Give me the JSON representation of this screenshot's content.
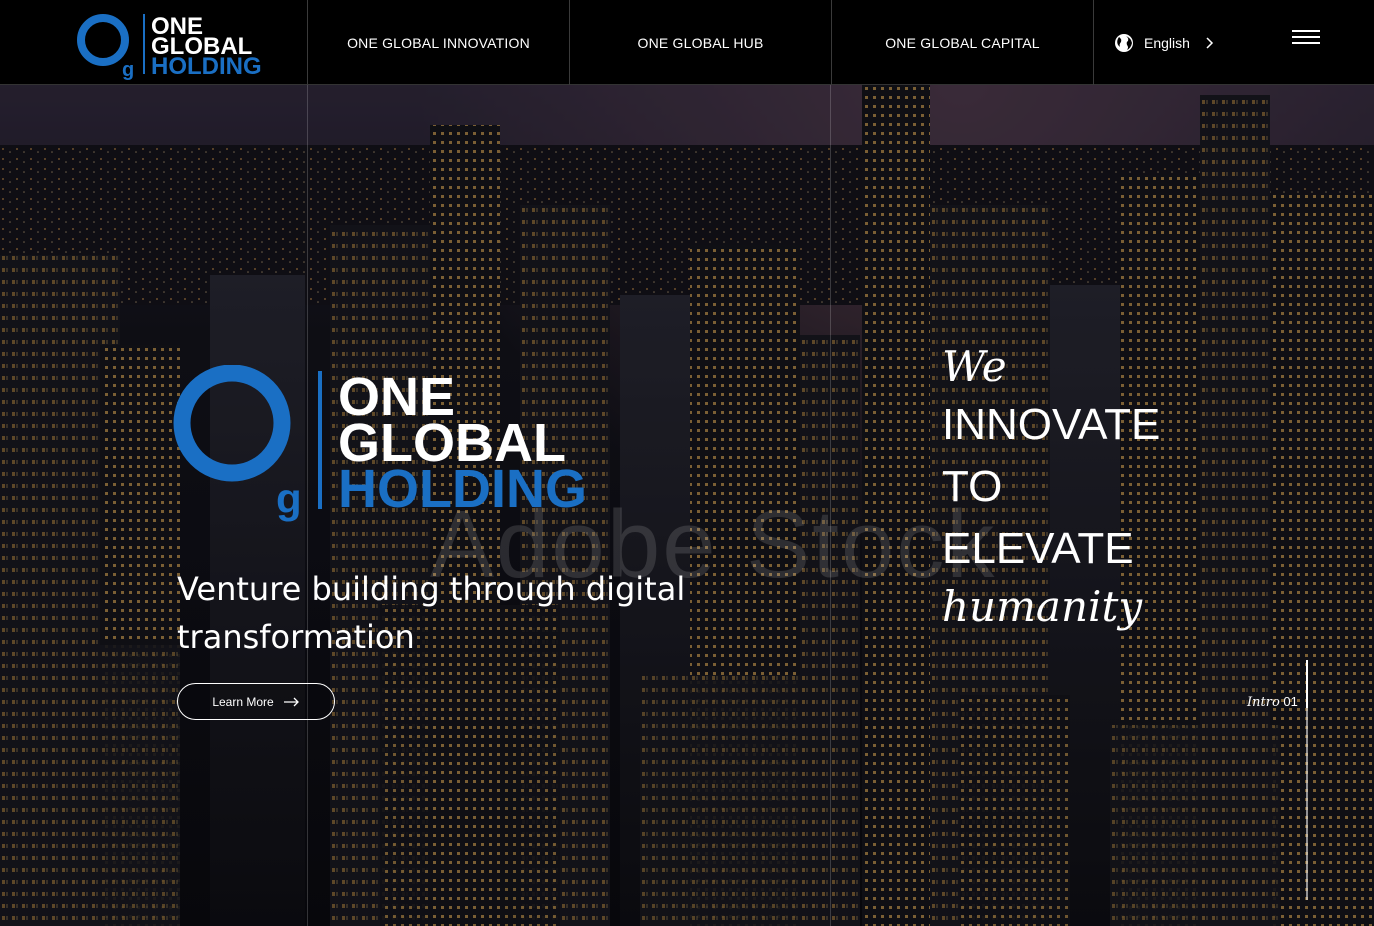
{
  "brand": {
    "line1": "ONE",
    "line2": "GLOBAL",
    "line3": "HOLDING",
    "mark_letter": "g"
  },
  "nav": {
    "items": [
      {
        "label": "ONE GLOBAL INNOVATION"
      },
      {
        "label": "ONE GLOBAL HUB"
      },
      {
        "label": "ONE GLOBAL CAPITAL"
      }
    ],
    "language": "English"
  },
  "hero": {
    "logo": {
      "line1": "ONE",
      "line2": "GLOBAL",
      "line3": "HOLDING",
      "mark_letter": "g"
    },
    "tagline": "Venture building through digital transformation",
    "cta_label": "Learn More",
    "slogan": {
      "we": "We",
      "innovate": "INNOVATE",
      "to": "TO",
      "elevate": "ELEVATE",
      "humanity": "humanity"
    },
    "intro_label": "Intro",
    "intro_number": "01",
    "watermark": "Adobe Stock"
  },
  "colors": {
    "brand_blue": "#1a6fc4",
    "header_bg": "#000000",
    "text": "#ffffff"
  },
  "icons": {
    "language": "globe-icon",
    "language_arrow": "chevron-right-icon",
    "menu": "hamburger-icon",
    "cta": "arrow-right-icon"
  }
}
